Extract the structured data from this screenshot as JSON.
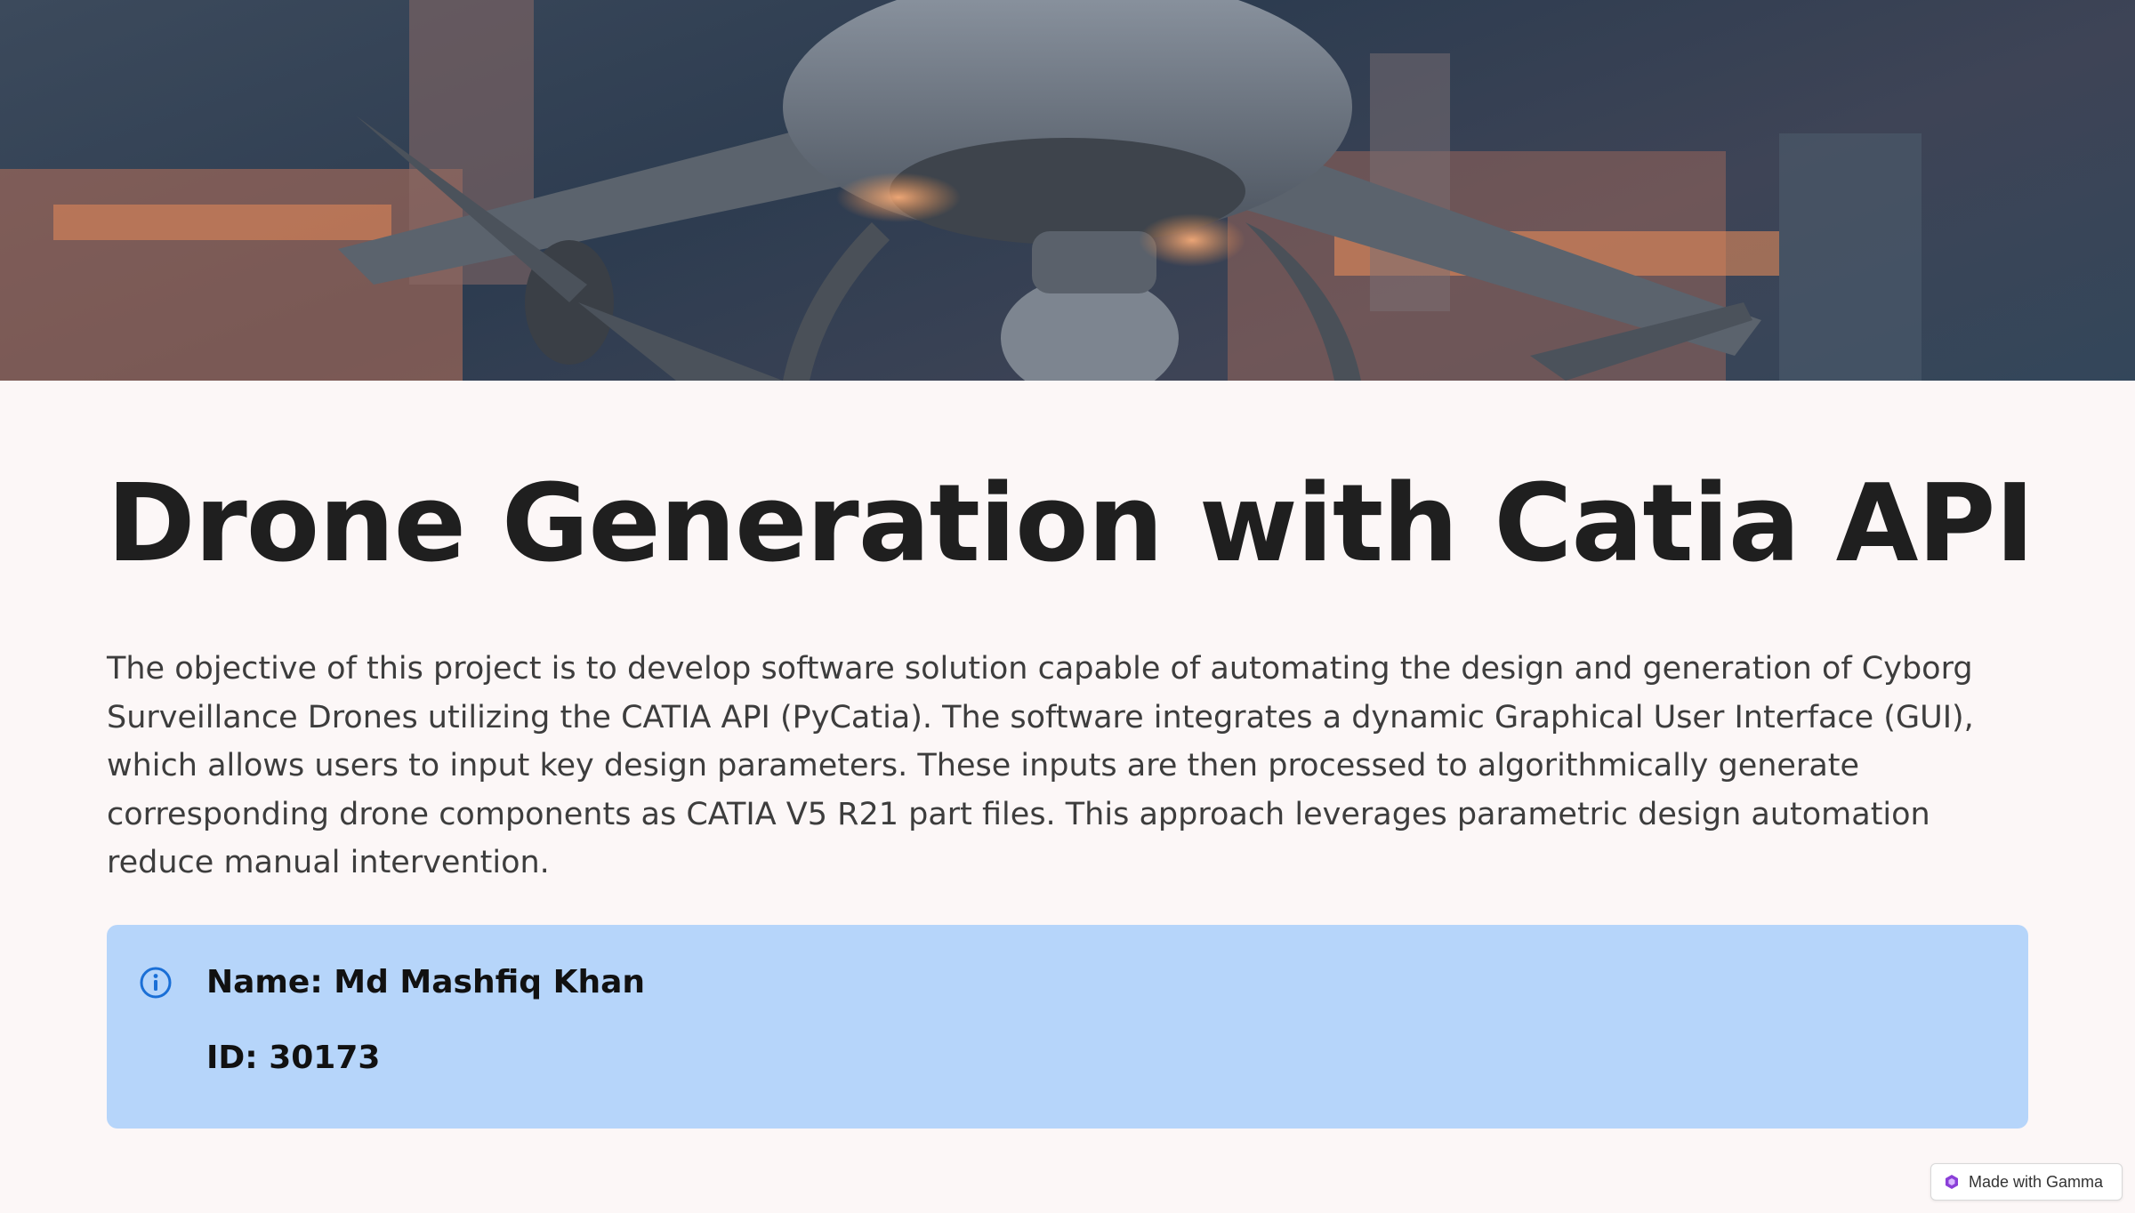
{
  "hero": {
    "image_description": "drone-image",
    "colors": {
      "sky": "#2d3c50",
      "glow": "#f4924a",
      "drone": "#6b7480"
    }
  },
  "slide": {
    "title": "Drone Generation with Catia API",
    "description": "The objective of this project is to develop software solution capable of automating the design and generation of Cyborg Surveillance Drones utilizing the CATIA API (PyCatia). The software integrates a dynamic Graphical User Interface (GUI), which allows users to input key design parameters. These inputs are then processed to algorithmically generate corresponding drone components as CATIA V5 R21 part files. This approach leverages parametric design automation reduce manual intervention."
  },
  "info": {
    "icon": "info-icon",
    "name_line": "Name: Md Mashfiq Khan",
    "id_line": "ID: 30173",
    "background": "#b6d5fa",
    "accent": "#1a6fd6"
  },
  "badge": {
    "icon": "gamma-logo-icon",
    "label": "Made with Gamma"
  }
}
